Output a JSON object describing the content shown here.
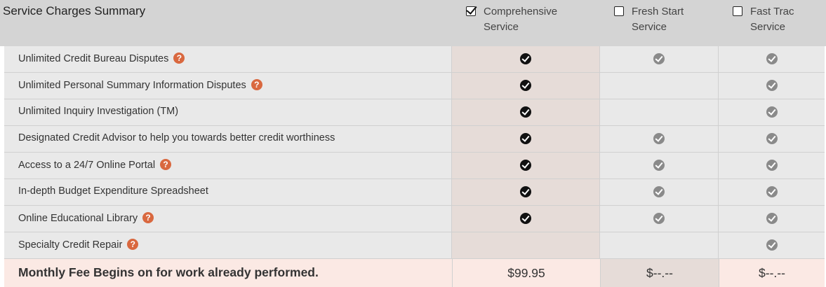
{
  "header": {
    "title": "Service Charges Summary",
    "plans": [
      {
        "line1": "Comprehensive",
        "line2": "Service",
        "checked": true
      },
      {
        "line1": "Fresh Start",
        "line2": "Service",
        "checked": false
      },
      {
        "line1": "Fast Trac",
        "line2": "Service",
        "checked": false
      }
    ]
  },
  "features": [
    {
      "label": "Unlimited Credit Bureau Disputes",
      "help": true,
      "comprehensive": true,
      "fresh_start": true,
      "fast_trac": true
    },
    {
      "label": "Unlimited Personal Summary Information Disputes",
      "help": true,
      "comprehensive": true,
      "fresh_start": false,
      "fast_trac": true
    },
    {
      "label": "Unlimited Inquiry Investigation (TM)",
      "help": false,
      "comprehensive": true,
      "fresh_start": false,
      "fast_trac": true
    },
    {
      "label": "Designated Credit Advisor to help you towards better credit worthiness",
      "help": false,
      "comprehensive": true,
      "fresh_start": true,
      "fast_trac": true
    },
    {
      "label": "Access to a 24/7 Online Portal",
      "help": true,
      "comprehensive": true,
      "fresh_start": true,
      "fast_trac": true
    },
    {
      "label": "In-depth Budget Expenditure Spreadsheet",
      "help": false,
      "comprehensive": true,
      "fresh_start": true,
      "fast_trac": true
    },
    {
      "label": "Online Educational Library",
      "help": true,
      "comprehensive": true,
      "fresh_start": true,
      "fast_trac": true
    },
    {
      "label": "Specialty Credit Repair",
      "help": true,
      "comprehensive": false,
      "fresh_start": false,
      "fast_trac": true
    }
  ],
  "footer": {
    "label": "Monthly Fee Begins on for work already performed.",
    "comprehensive_price": "$99.95",
    "fresh_start_price": "$--.--",
    "fast_trac_price": "$--.--"
  },
  "icons": {
    "help": "question-circle-icon",
    "check": "check-circle-icon"
  },
  "colors": {
    "help_icon": "#d9683f",
    "selected_column": "#e6dcd8",
    "footer_bg": "#fbe9e4",
    "header_bg": "#d4d4d4"
  }
}
